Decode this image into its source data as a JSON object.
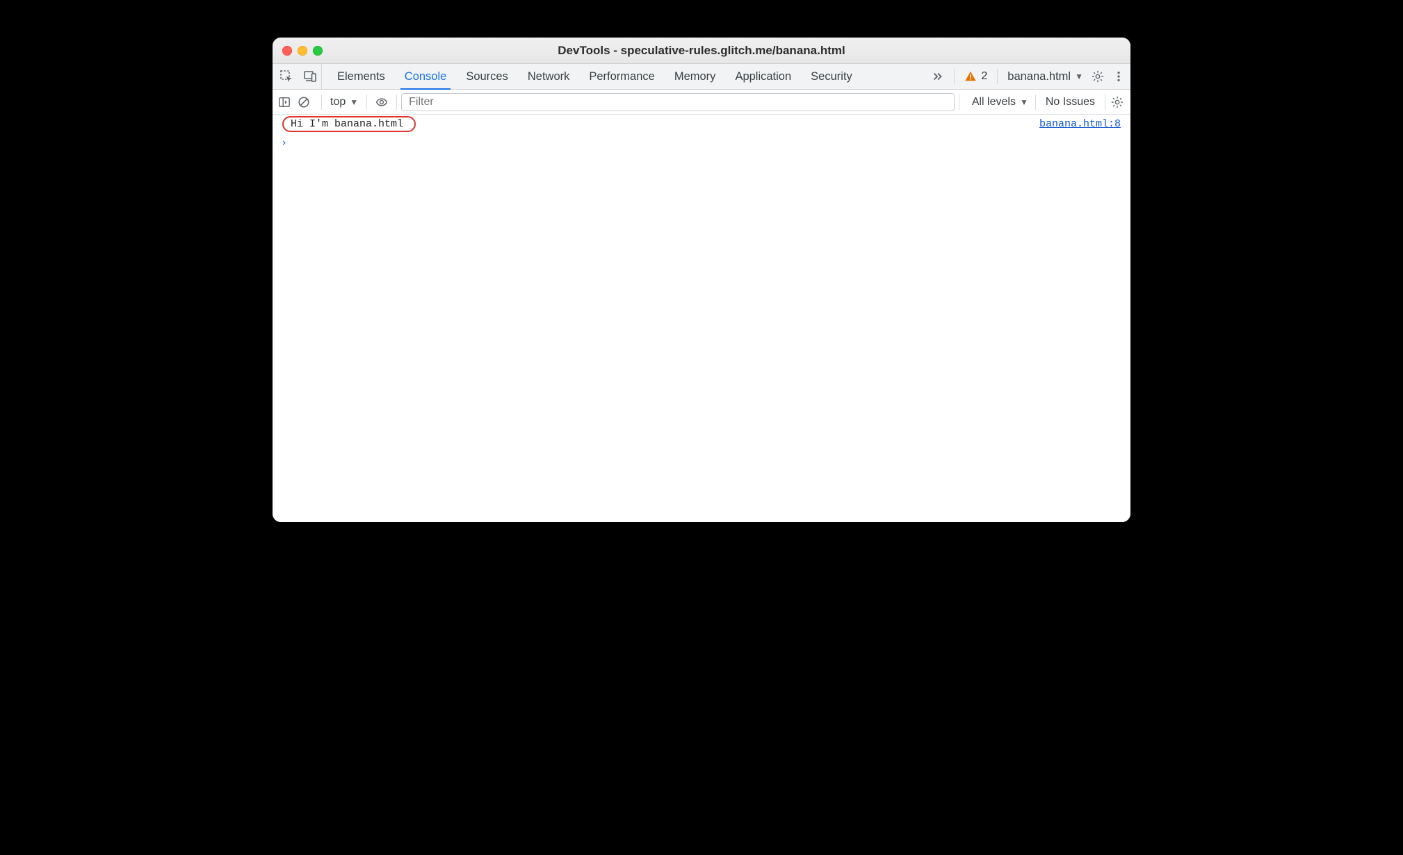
{
  "window": {
    "title": "DevTools - speculative-rules.glitch.me/banana.html"
  },
  "toolbar": {
    "tabs": [
      {
        "label": "Elements",
        "active": false
      },
      {
        "label": "Console",
        "active": true
      },
      {
        "label": "Sources",
        "active": false
      },
      {
        "label": "Network",
        "active": false
      },
      {
        "label": "Performance",
        "active": false
      },
      {
        "label": "Memory",
        "active": false
      },
      {
        "label": "Application",
        "active": false
      },
      {
        "label": "Security",
        "active": false
      }
    ],
    "warning_count": "2",
    "context_target": "banana.html"
  },
  "filterbar": {
    "scope": "top",
    "filter_placeholder": "Filter",
    "levels_label": "All levels",
    "issues_label": "No Issues"
  },
  "console": {
    "rows": [
      {
        "message": "Hi I'm banana.html",
        "source": "banana.html:8"
      }
    ]
  }
}
